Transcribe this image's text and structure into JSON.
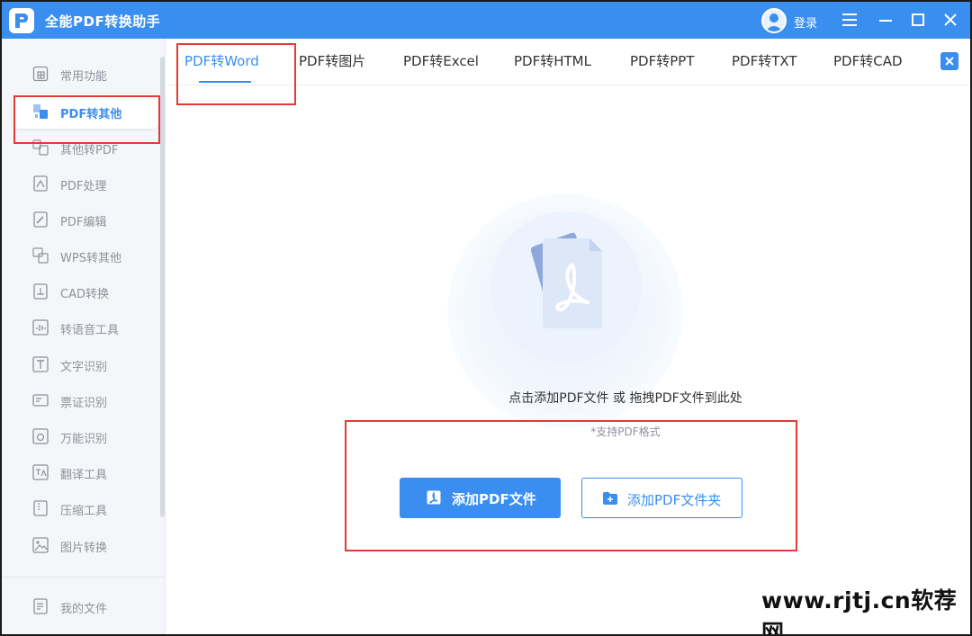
{
  "window": {
    "title": "全能PDF转换助手",
    "login_label": "登录"
  },
  "colors": {
    "accent": "#3a8ef0",
    "annotation": "#e53935",
    "sidebar_bg": "#f4f6fa",
    "muted_text": "#8d929b"
  },
  "sidebar": {
    "items": [
      {
        "label": "常用功能",
        "icon": "grid-icon"
      },
      {
        "label": "PDF转其他",
        "icon": "convert-icon",
        "active": true
      },
      {
        "label": "其他转PDF",
        "icon": "to-pdf-icon"
      },
      {
        "label": "PDF处理",
        "icon": "pdf-process-icon"
      },
      {
        "label": "PDF编辑",
        "icon": "pdf-edit-icon"
      },
      {
        "label": "WPS转其他",
        "icon": "wps-icon"
      },
      {
        "label": "CAD转换",
        "icon": "cad-icon"
      },
      {
        "label": "转语音工具",
        "icon": "audio-icon"
      },
      {
        "label": "文字识别",
        "icon": "ocr-icon"
      },
      {
        "label": "票证识别",
        "icon": "ticket-icon"
      },
      {
        "label": "万能识别",
        "icon": "camera-icon"
      },
      {
        "label": "翻译工具",
        "icon": "translate-icon"
      },
      {
        "label": "压缩工具",
        "icon": "compress-icon"
      },
      {
        "label": "图片转换",
        "icon": "image-icon"
      }
    ],
    "footer_item": {
      "label": "我的文件",
      "icon": "file-icon"
    }
  },
  "tabs": [
    {
      "label": "PDF转Word",
      "active": true
    },
    {
      "label": "PDF转图片"
    },
    {
      "label": "PDF转Excel"
    },
    {
      "label": "PDF转HTML"
    },
    {
      "label": "PDF转PPT"
    },
    {
      "label": "PDF转TXT"
    },
    {
      "label": "PDF转CAD"
    }
  ],
  "main": {
    "hero_icon": "pdf-document-icon",
    "drop_hint": "点击添加PDF文件 或 拖拽PDF文件到此处",
    "format_hint": "*支持PDF格式",
    "add_file_label": "添加PDF文件",
    "add_folder_label": "添加PDF文件夹"
  },
  "watermark": "www.rjtj.cn软荐网"
}
